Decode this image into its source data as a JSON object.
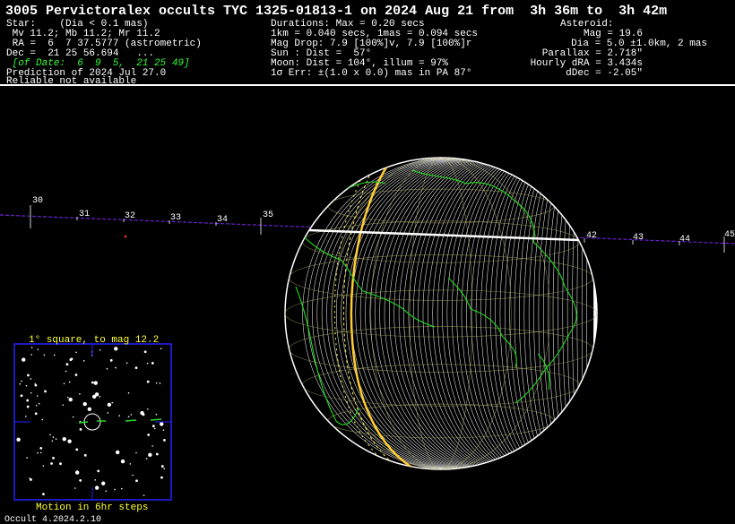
{
  "header": {
    "title": "3005 Pervictoralex occults TYC 1325-01813-1 on 2024 Aug 21 from  3h 36m to  3h 42m",
    "col1": {
      "star_label": "Star:    (Dia < 0.1 mas)",
      "mags": " Mv 11.2; Mb 11.2; Mr 11.2",
      "ra": " RA =  6  7 37.5777 (astrometric)",
      "dec": "Dec =  21 25 56.694   ...",
      "of_date": " [of Date:  6  9  5,  21 25 49]",
      "prediction": "Prediction of 2024 Jul 27.0",
      "reliable": "Reliable not available"
    },
    "col2": {
      "durations": "Durations: Max = 0.20 secs",
      "km": "1km = 0.040 secs, 1mas = 0.094 secs",
      "mag_drop": "Mag Drop: 7.9 [100%]v, 7.9 [100%]r",
      "sun": "Sun : Dist =  57°",
      "moon": "Moon: Dist = 104°, illum = 97%",
      "err": "1σ Err: ±(1.0 x 0.0) mas in PA 87°"
    },
    "col3": {
      "asteroid": "Asteroid:",
      "mag": "Mag = 19.6",
      "dia": "Dia = 5.0 ±1.0km, 2 mas",
      "parallax": "Parallax = 2.718\"",
      "hourly_dra": "Hourly dRA = 3.434s",
      "ddec": "dDec = -2.05\""
    }
  },
  "path_ticks": {
    "labels": [
      "30",
      "31",
      "32",
      "33",
      "34",
      "35",
      "42",
      "43",
      "44",
      "45"
    ]
  },
  "inset": {
    "title": "1° square, to mag 12.2",
    "caption": "Motion in 6hr steps"
  },
  "footer": {
    "version": "Occult 4.2024.2.10"
  },
  "colors": {
    "text": "#ffffff",
    "highlight_text": "#33ff33",
    "inset_text": "#ffff33",
    "coastline": "#22dd22",
    "path_track": "#6a22cc",
    "shadow_edge": "#ffcc33",
    "inset_border": "#2222ff"
  }
}
